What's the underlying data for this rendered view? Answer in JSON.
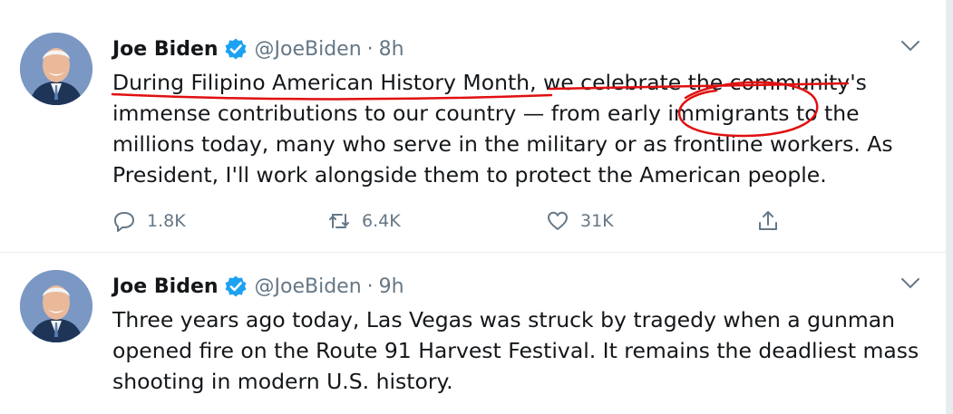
{
  "tweets": [
    {
      "author_name": "Joe Biden",
      "author_handle": "@JoeBiden",
      "separator": "·",
      "time": "8h",
      "text": "During Filipino American History Month, we celebrate the community's immense contributions to our country — from early immigrants to the millions today, many who serve in the military or as frontline workers. As President, I'll work alongside them to protect the American people.",
      "reply_count": "1.8K",
      "retweet_count": "6.4K",
      "like_count": "31K"
    },
    {
      "author_name": "Joe Biden",
      "author_handle": "@JoeBiden",
      "separator": "·",
      "time": "9h",
      "text": "Three years ago today, Las Vegas was struck by tragedy when a gunman opened fire on the Route 91 Harvest Festival. It remains the deadliest mass shooting in modern U.S. history."
    }
  ],
  "colors": {
    "verified_blue": "#1da1f2",
    "secondary_text": "#657786",
    "annotation_red": "#e01010"
  },
  "icons": [
    "verified-badge-icon",
    "chevron-down-icon",
    "reply-icon",
    "retweet-icon",
    "like-icon",
    "share-icon"
  ]
}
